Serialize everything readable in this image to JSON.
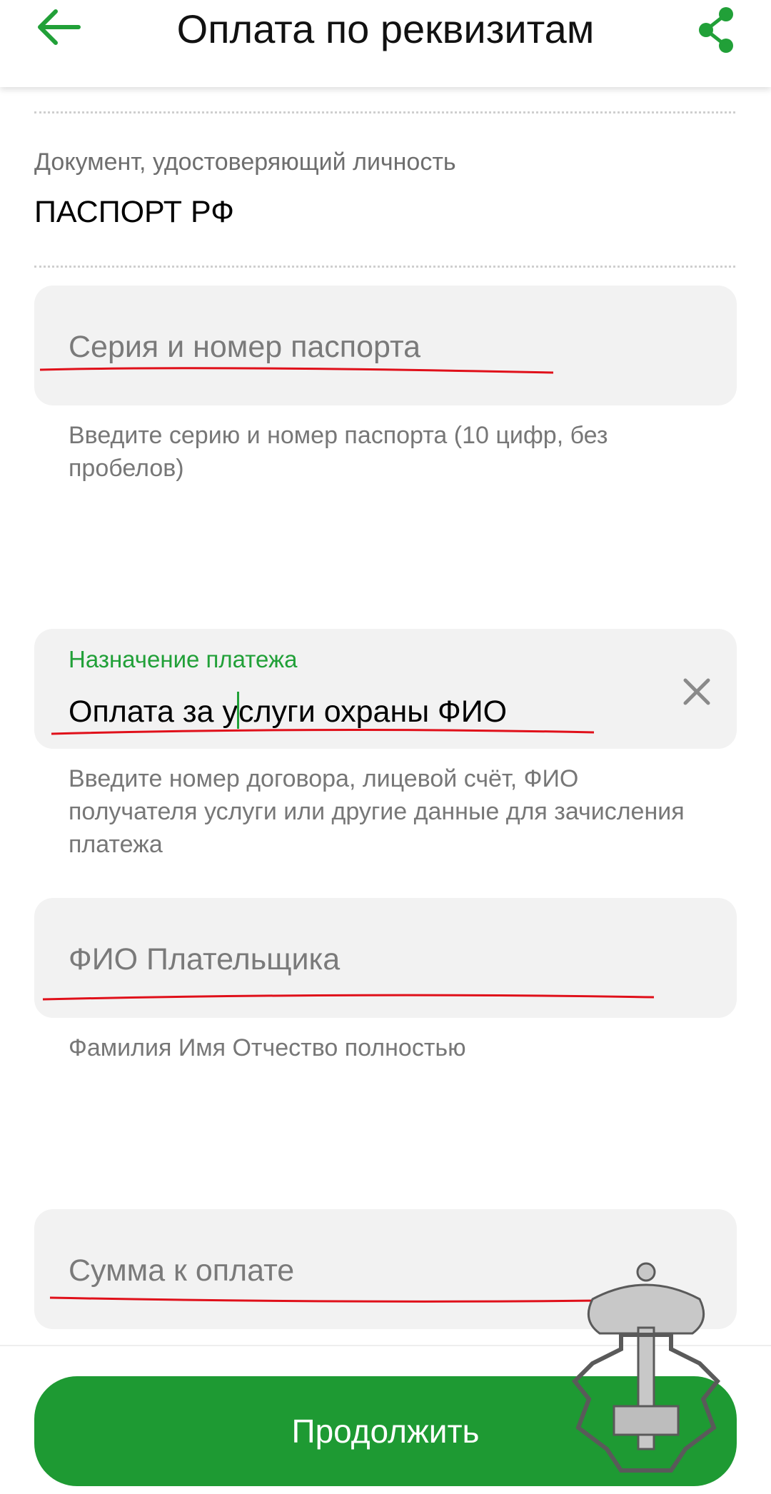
{
  "header": {
    "title": "Оплата по реквизитам",
    "back_icon": "arrow-left-icon",
    "share_icon": "share-icon",
    "accent_color": "#21a038"
  },
  "document": {
    "label": "Документ, удостоверяющий личность",
    "value": "ПАСПОРТ РФ"
  },
  "passport": {
    "placeholder": "Серия и номер паспорта",
    "hint": "Введите серию и номер паспорта (10 цифр, без пробелов)"
  },
  "purpose": {
    "label": "Назначение платежа",
    "value_before_cursor": "Оплата за у",
    "value_after_cursor": "слуги охраны ФИО",
    "clear_icon": "close-icon",
    "hint": "Введите номер договора, лицевой счёт,  ФИО получателя услуги или другие данные для зачисления платежа"
  },
  "payer": {
    "placeholder": "ФИО Плательщика",
    "hint": "Фамилия Имя Отчество полностью"
  },
  "amount": {
    "placeholder": "Сумма к оплате"
  },
  "continue_button": {
    "label": "Продолжить",
    "color": "#1e9a33"
  },
  "annotations": {
    "underline_color": "#e0101a"
  }
}
